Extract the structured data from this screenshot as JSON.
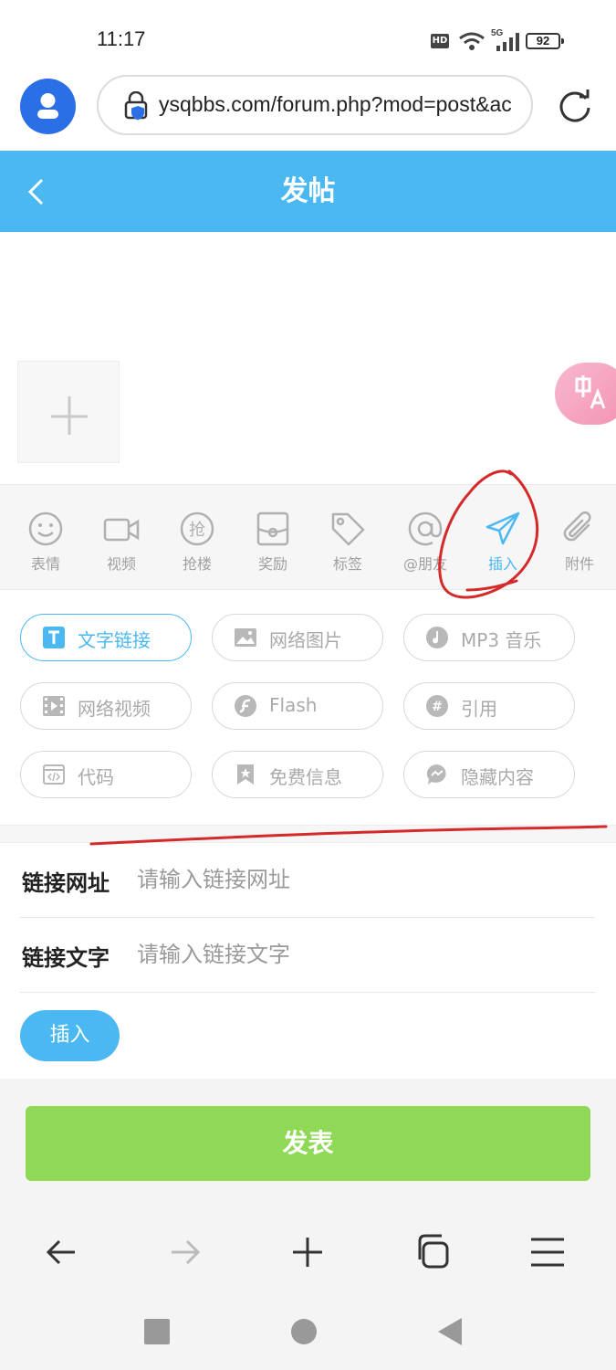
{
  "status_bar": {
    "time": "11:17",
    "hd": "HD",
    "network": "5G",
    "battery": "92"
  },
  "browser": {
    "url": "ysqbbs.com/forum.php?mod=post&ac"
  },
  "header": {
    "title": "发帖"
  },
  "toolbar": {
    "items": [
      {
        "label": "表情",
        "icon": "smiley-icon"
      },
      {
        "label": "视频",
        "icon": "video-camera-icon"
      },
      {
        "label": "抢楼",
        "icon": "grab-floor-icon"
      },
      {
        "label": "奖励",
        "icon": "reward-icon"
      },
      {
        "label": "标签",
        "icon": "tag-icon"
      },
      {
        "label": "@朋友",
        "icon": "at-sign-icon"
      },
      {
        "label": "插入",
        "icon": "paper-plane-icon",
        "active": true
      },
      {
        "label": "附件",
        "icon": "paperclip-icon"
      }
    ]
  },
  "insert_options": [
    {
      "label": "文字链接",
      "icon": "text-link-icon",
      "selected": true
    },
    {
      "label": "网络图片",
      "icon": "image-icon"
    },
    {
      "label": "MP3 音乐",
      "icon": "music-icon"
    },
    {
      "label": "网络视频",
      "icon": "film-icon"
    },
    {
      "label": "Flash",
      "icon": "flash-icon"
    },
    {
      "label": "引用",
      "icon": "quote-icon"
    },
    {
      "label": "代码",
      "icon": "code-icon"
    },
    {
      "label": "免费信息",
      "icon": "bookmark-star-icon"
    },
    {
      "label": "隐藏内容",
      "icon": "chat-bubble-icon"
    }
  ],
  "link_form": {
    "url_label": "链接网址",
    "url_placeholder": "请输入链接网址",
    "text_label": "链接文字",
    "text_placeholder": "请输入链接文字",
    "insert_button": "插入"
  },
  "publish_button": "发表",
  "colors": {
    "accent": "#4bb8f2",
    "publish": "#8fd956",
    "annotation": "#d42a2a"
  }
}
